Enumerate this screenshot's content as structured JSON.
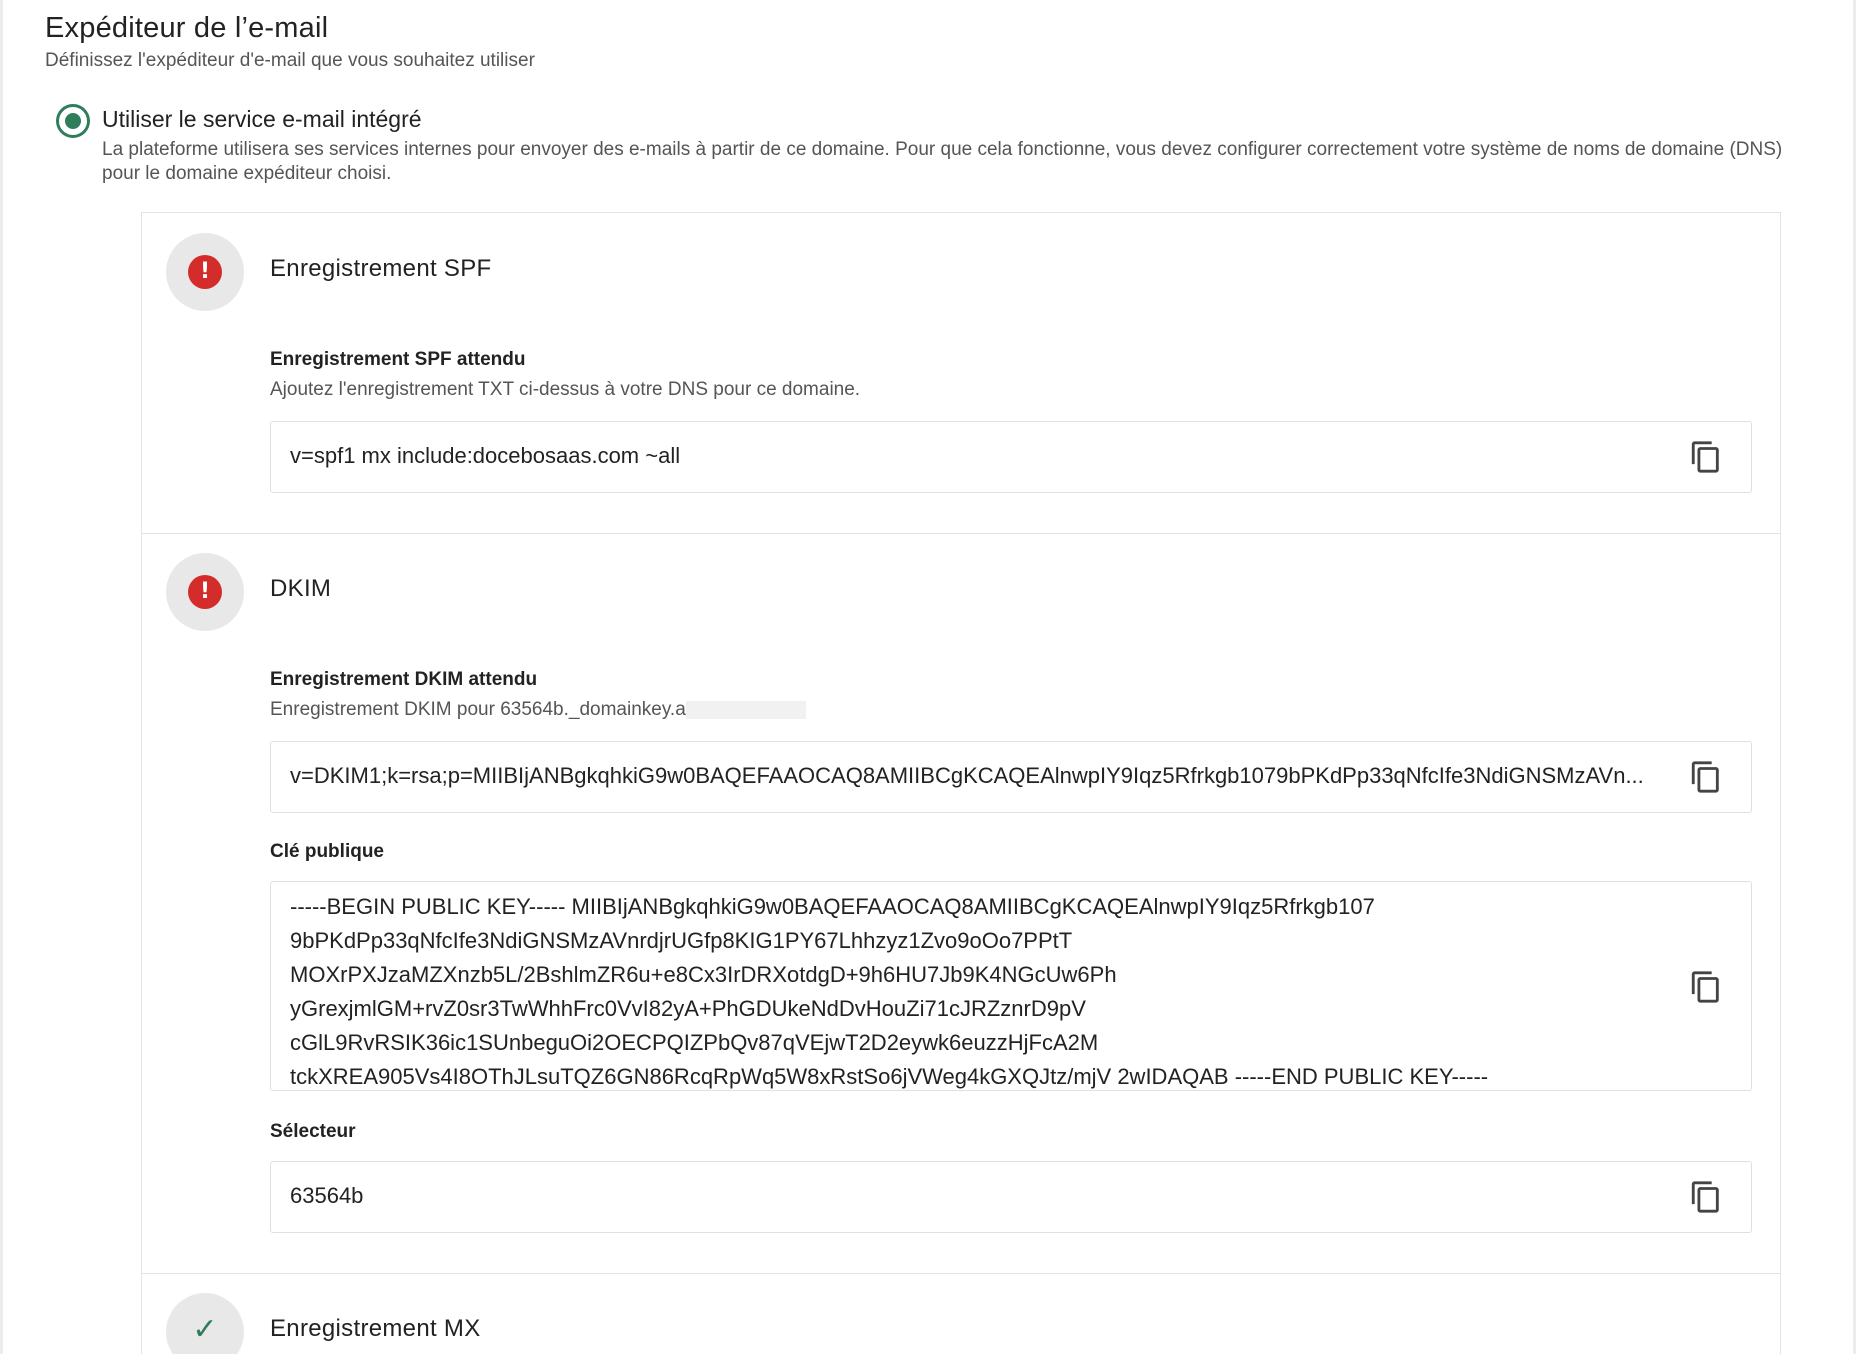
{
  "section": {
    "title": "Expéditeur de l’e-mail",
    "subtitle": "Définissez l'expéditeur d'e-mail que vous souhaitez utiliser"
  },
  "option": {
    "label": "Utiliser le service e-mail intégré",
    "description": "La plateforme utilisera ses services internes pour envoyer des e-mails à partir de ce domaine. Pour que cela fonctionne, vous devez configurer correctement votre système de noms de domaine (DNS) pour le domaine expéditeur choisi.",
    "selected": true
  },
  "spf": {
    "status": "error",
    "title": "Enregistrement SPF",
    "expected_label": "Enregistrement SPF attendu",
    "expected_help": "Ajoutez l'enregistrement TXT ci-dessus à votre DNS pour ce domaine.",
    "value": "v=spf1 mx include:docebosaas.com ~all"
  },
  "dkim": {
    "status": "error",
    "title": "DKIM",
    "expected_label": "Enregistrement DKIM attendu",
    "expected_help": "Enregistrement DKIM pour 63564b._domainkey.a",
    "value": "v=DKIM1;k=rsa;p=MIIBIjANBgkqhkiG9w0BAQEFAAOCAQ8AMIIBCgKCAQEAlnwpIY9Iqz5Rfrkgb1079bPKdPp33qNfcIfe3NdiGNSMzAVn...",
    "public_key_label": "Clé publique",
    "public_key_lines": [
      "-----BEGIN PUBLIC KEY----- MIIBIjANBgkqhkiG9w0BAQEFAAOCAQ8AMIIBCgKCAQEAlnwpIY9Iqz5Rfrkgb107",
      "9bPKdPp33qNfcIfe3NdiGNSMzAVnrdjrUGfp8KIG1PY67Lhhzyz1Zvo9oOo7PPtT",
      "MOXrPXJzaMZXnzb5L/2BshlmZR6u+e8Cx3IrDRXotdgD+9h6HU7Jb9K4NGcUw6Ph",
      "yGrexjmlGM+rvZ0sr3TwWhhFrc0VvI82yA+PhGDUkeNdDvHouZi71cJRZznrD9pV",
      "cGlL9RvRSIK36ic1SUnbeguOi2OECPQIZPbQv87qVEjwT2D2eywk6euzzHjFcA2M",
      "tckXREA905Vs4I8OThJLsuTQZ6GN86RcqRpWq5W8xRstSo6jVWeg4kGXQJtz/mjV 2wIDAQAB -----END PUBLIC KEY-----"
    ],
    "selector_label": "Sélecteur",
    "selector_value": "63564b"
  },
  "mx": {
    "status": "ok",
    "title": "Enregistrement MX"
  },
  "colors": {
    "accent": "#2e7d5b",
    "error": "#d42b2b",
    "status_bg": "#e8e8e8",
    "border": "#e3e3e3"
  },
  "icons": {
    "copy": "copy-icon",
    "error": "exclamation-circle-icon",
    "ok": "check-icon"
  }
}
